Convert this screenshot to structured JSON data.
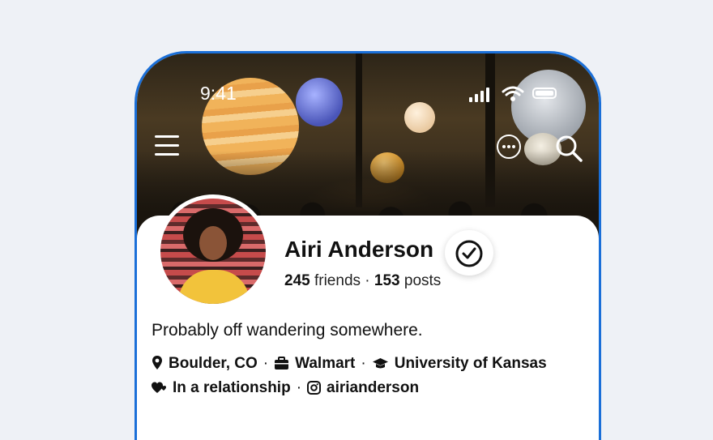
{
  "status_bar": {
    "time": "9:41"
  },
  "profile": {
    "name": "Airi Anderson",
    "friends_count": "245",
    "friends_label": "friends",
    "separator": "·",
    "posts_count": "153",
    "posts_label": "posts",
    "bio": "Probably off wandering somewhere."
  },
  "details": {
    "location": "Boulder, CO",
    "work": "Walmart",
    "education": "University of Kansas",
    "relationship": "In a relationship",
    "instagram": "airianderson"
  },
  "colors": {
    "accent_border": "#1a6fd8",
    "background": "#eef1f6"
  },
  "icons": [
    "menu-icon",
    "more-icon",
    "search-icon",
    "verified-icon",
    "location-pin-icon",
    "briefcase-icon",
    "graduation-cap-icon",
    "hearts-icon",
    "instagram-icon"
  ]
}
